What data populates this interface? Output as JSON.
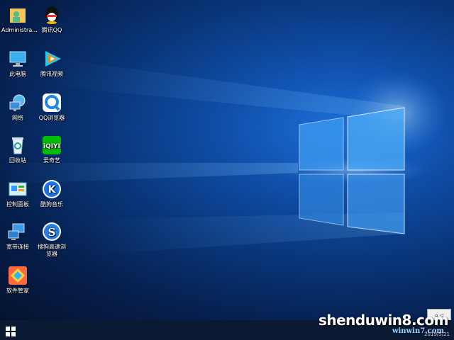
{
  "desktop_icons": [
    {
      "label": "Administra...",
      "icon": "user-folder-icon"
    },
    {
      "label": "腾讯QQ",
      "icon": "qq-penguin-icon"
    },
    {
      "label": "此电脑",
      "icon": "computer-icon"
    },
    {
      "label": "腾讯视频",
      "icon": "tencent-video-icon"
    },
    {
      "label": "网络",
      "icon": "network-icon"
    },
    {
      "label": "QQ浏览器",
      "icon": "qq-browser-icon"
    },
    {
      "label": "回收站",
      "icon": "recycle-bin-icon"
    },
    {
      "label": "爱奇艺",
      "icon": "iqiyi-icon"
    },
    {
      "label": "控制面板",
      "icon": "control-panel-icon"
    },
    {
      "label": "酷狗音乐",
      "icon": "kugou-icon"
    },
    {
      "label": "宽带连接",
      "icon": "broadband-icon"
    },
    {
      "label": "搜狗高速浏览器",
      "icon": "sogou-browser-icon"
    },
    {
      "label": "软件管家",
      "icon": "software-manager-icon"
    }
  ],
  "watermark": {
    "main": "shenduwin8.com",
    "sub": "winwin7.com"
  },
  "taskbar": {
    "date": "2019/5/21",
    "tray_label": "⌂ ◁"
  },
  "colors": {
    "desktop": "#0f4ea8",
    "taskbar": "#0a1a33",
    "iqiyi": "#00be06",
    "qq_browser": "#1e88e5"
  }
}
